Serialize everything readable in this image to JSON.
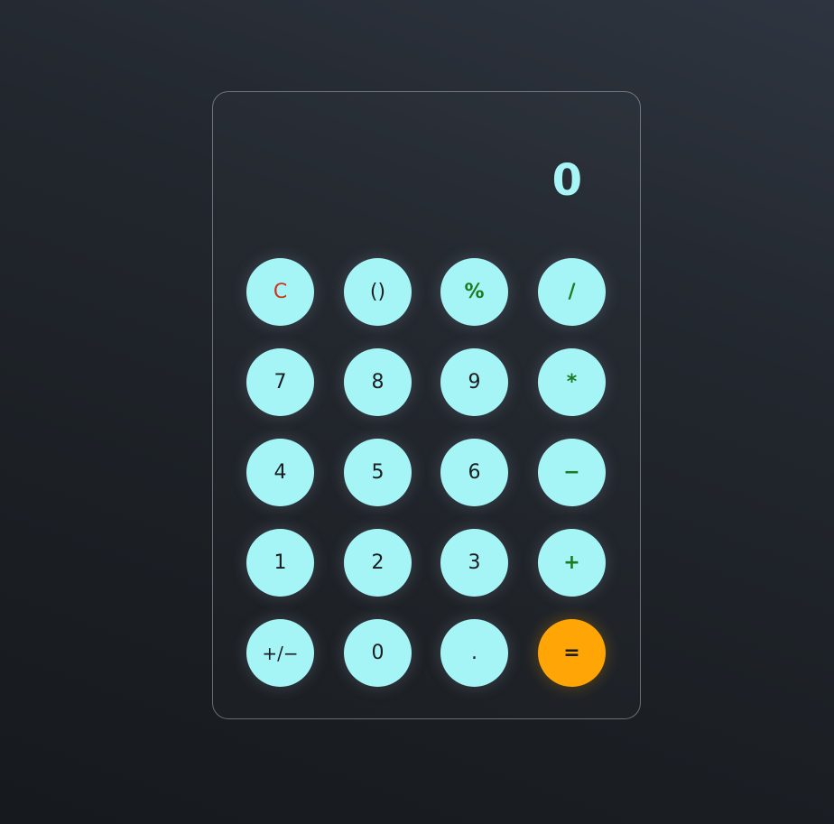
{
  "display": {
    "value": "0"
  },
  "keys": {
    "clear": "C",
    "parens": "()",
    "percent": "%",
    "divide": "/",
    "seven": "7",
    "eight": "8",
    "nine": "9",
    "multiply": "*",
    "four": "4",
    "five": "5",
    "six": "6",
    "subtract": "−",
    "one": "1",
    "two": "2",
    "three": "3",
    "add": "+",
    "negate": "+/−",
    "zero": "0",
    "decimal": ".",
    "equals": "="
  },
  "colors": {
    "key_background": "#a6f5f6",
    "equals_background": "#ffa505",
    "operator_text": "#1e7a22",
    "clear_text": "#d0331c",
    "display_text": "#a7f5f6"
  }
}
